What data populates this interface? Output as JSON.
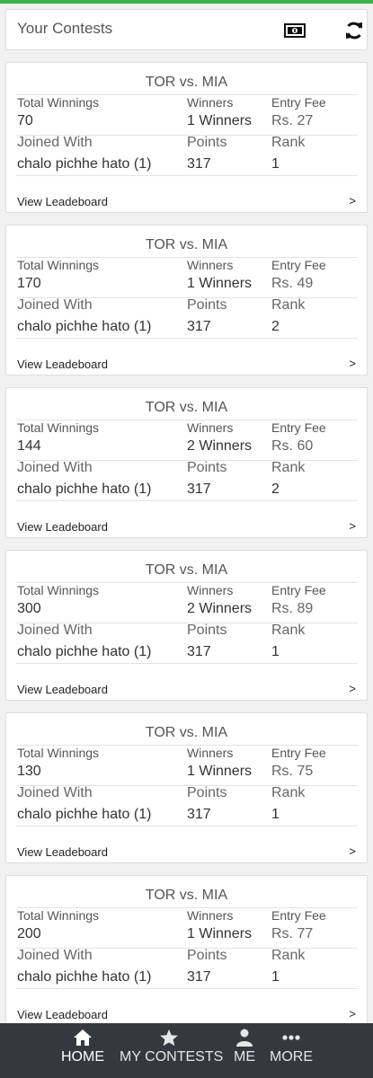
{
  "header": {
    "title": "Your Contests",
    "icons": [
      "money-icon",
      "refresh-icon"
    ]
  },
  "labels": {
    "total_winnings": "Total Winnings",
    "winners": "Winners",
    "entry_fee": "Entry Fee",
    "joined_with": "Joined With",
    "points": "Points",
    "rank": "Rank",
    "view_leaderboard": "View Leadeboard",
    "arrow": ">"
  },
  "contests": [
    {
      "match": "TOR vs. MIA",
      "total_winnings": "70",
      "winners": "1 Winners",
      "entry_fee": "Rs. 27",
      "joined_with": "chalo pichhe hato (1)",
      "points": "317",
      "rank": "1"
    },
    {
      "match": "TOR vs. MIA",
      "total_winnings": "170",
      "winners": "1 Winners",
      "entry_fee": "Rs. 49",
      "joined_with": "chalo pichhe hato (1)",
      "points": "317",
      "rank": "2"
    },
    {
      "match": "TOR vs. MIA",
      "total_winnings": "144",
      "winners": "2 Winners",
      "entry_fee": "Rs. 60",
      "joined_with": "chalo pichhe hato (1)",
      "points": "317",
      "rank": "2"
    },
    {
      "match": "TOR vs. MIA",
      "total_winnings": "300",
      "winners": "2 Winners",
      "entry_fee": "Rs. 89",
      "joined_with": "chalo pichhe hato (1)",
      "points": "317",
      "rank": "1"
    },
    {
      "match": "TOR vs. MIA",
      "total_winnings": "130",
      "winners": "1 Winners",
      "entry_fee": "Rs. 75",
      "joined_with": "chalo pichhe hato (1)",
      "points": "317",
      "rank": "1"
    },
    {
      "match": "TOR vs. MIA",
      "total_winnings": "200",
      "winners": "1 Winners",
      "entry_fee": "Rs. 77",
      "joined_with": "chalo pichhe hato (1)",
      "points": "317",
      "rank": "1"
    }
  ],
  "nav": [
    {
      "label": "HOME",
      "icon": "home-icon",
      "active": true
    },
    {
      "label": "MY CONTESTS",
      "icon": "star-icon",
      "active": false
    },
    {
      "label": "ME",
      "icon": "user-icon",
      "active": false
    },
    {
      "label": "MORE",
      "icon": "more-icon",
      "active": false
    }
  ],
  "colors": {
    "accent": "#3bb54a",
    "nav_bg": "#35383d",
    "card_bg": "#ffffff",
    "page_bg": "#f1f1f1"
  }
}
